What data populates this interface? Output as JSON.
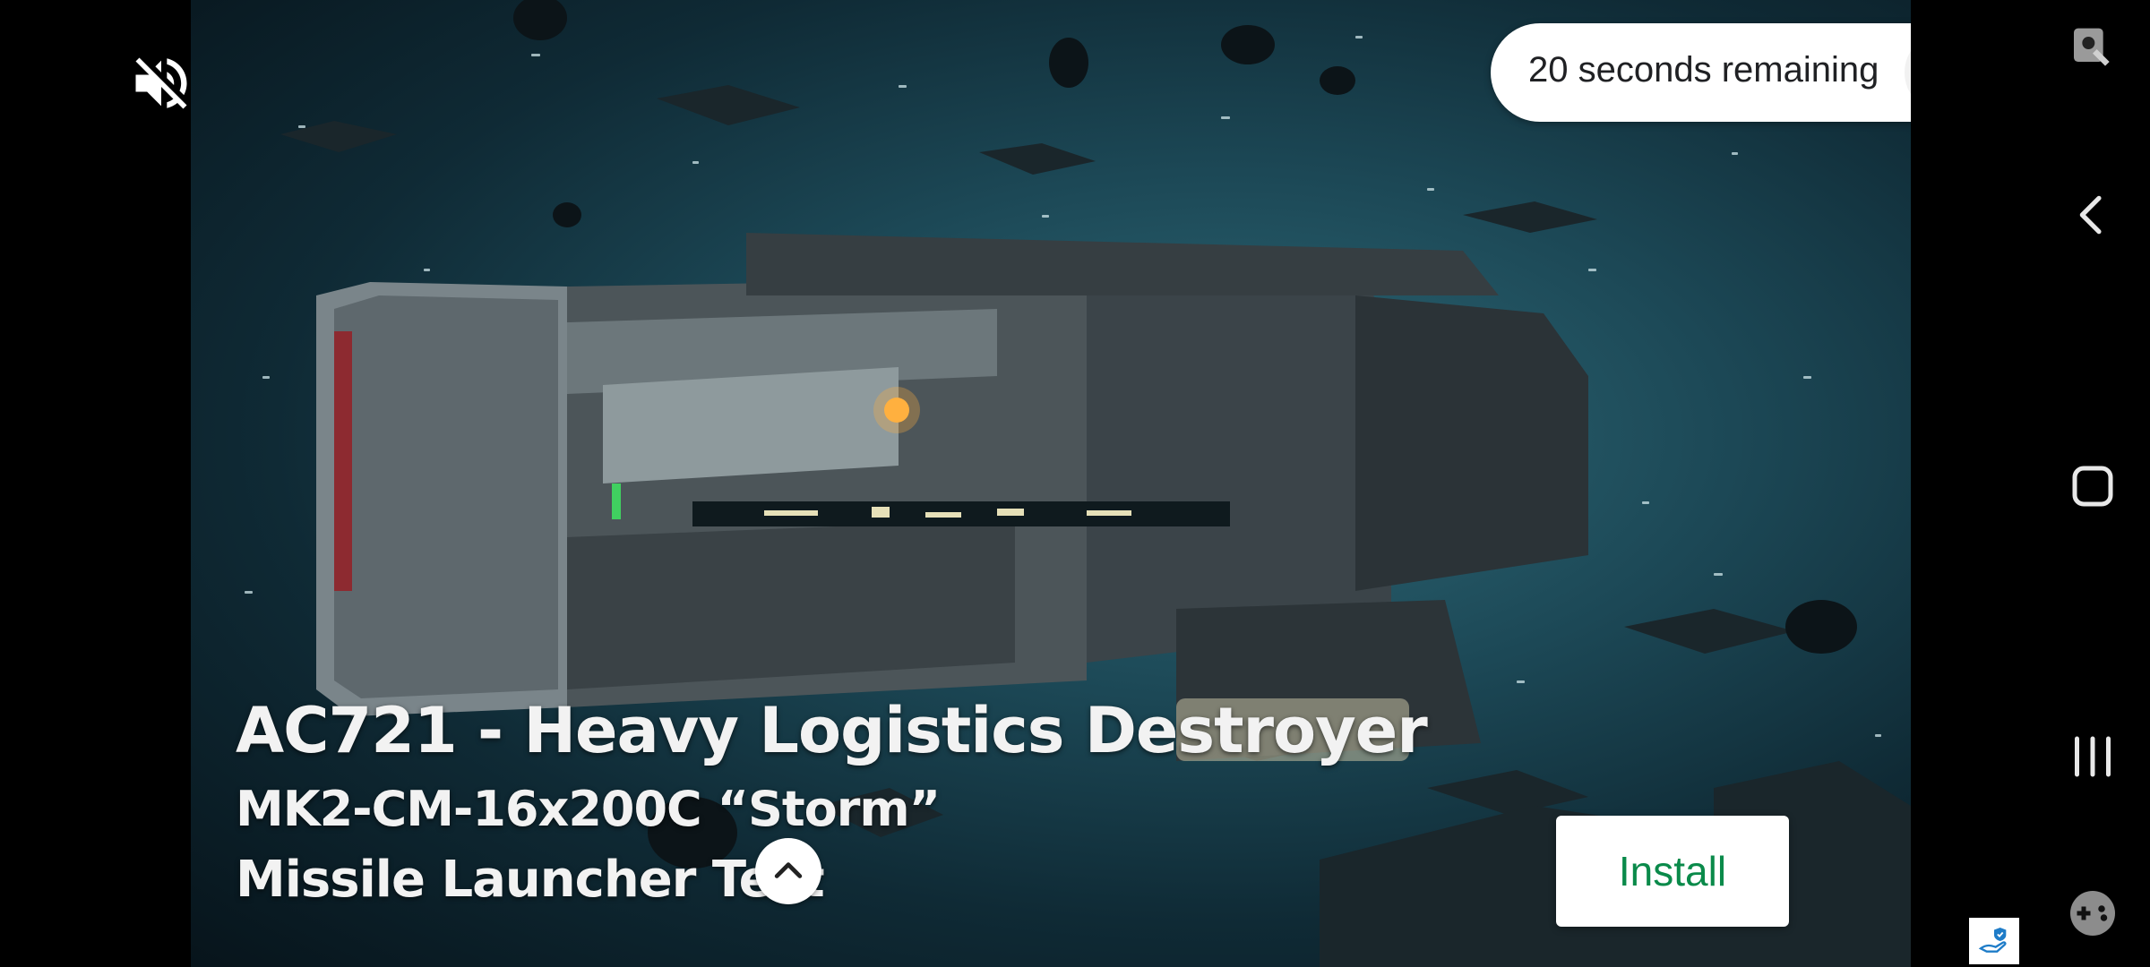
{
  "ad": {
    "caption_line1": "AC721 - Heavy Logistics Destroyer",
    "caption_line2": "MK2-CM-16x200C “Storm”",
    "caption_line3": "Missile Launcher Test",
    "install_label": "Install"
  },
  "timer": {
    "text": "20 seconds remaining"
  },
  "icons": {
    "mute": "volume-mute-icon",
    "close": "close-icon",
    "collapse": "chevron-up-icon",
    "back": "back-icon",
    "home": "home-icon",
    "recents": "recents-icon",
    "game": "game-controller-icon",
    "screen_lock": "touch-lock-icon",
    "ad_choices": "ad-choices-icon"
  },
  "colors": {
    "install_text": "#0a8a4a",
    "background": "#000000"
  }
}
